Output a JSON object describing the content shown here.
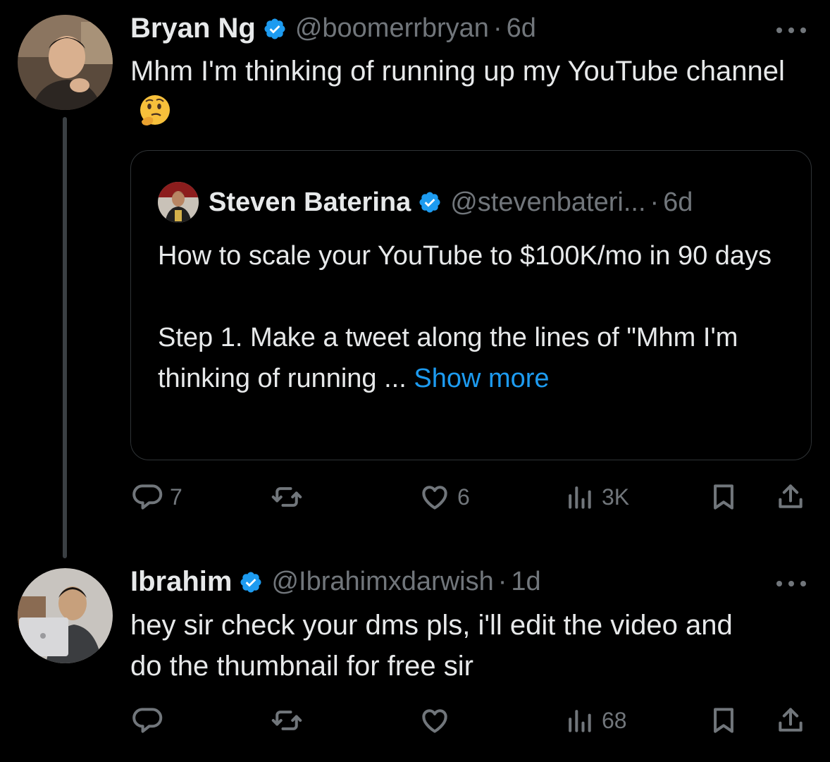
{
  "tweet1": {
    "author_name": "Bryan Ng",
    "handle": "@boomerrbryan",
    "dot": "·",
    "time": "6d",
    "text": "Mhm I'm thinking of running up my YouTube channel",
    "emoji": "thinking-face-emoji",
    "quote": {
      "author_name": "Steven Baterina",
      "handle": "@stevenbateri...",
      "dot": "·",
      "time": "6d",
      "paragraph1": "How to scale your YouTube to $100K/mo in 90 days",
      "paragraph2": "Step 1. Make a tweet along the lines of \"Mhm I'm thinking of running ...",
      "show_more": "Show more"
    },
    "actions": {
      "replies": "7",
      "reposts": "",
      "likes": "6",
      "views": "3K"
    }
  },
  "tweet2": {
    "author_name": "Ibrahim",
    "handle": "@Ibrahimxdarwish",
    "dot": "·",
    "time": "1d",
    "text": "hey sir check your dms pls, i'll edit the video and do the thumbnail for free sir",
    "actions": {
      "replies": "",
      "reposts": "",
      "likes": "",
      "views": "68"
    }
  },
  "colors": {
    "background": "#000000",
    "primary_text": "#e7e9ea",
    "secondary_text": "#71767b",
    "accent_link": "#1d9bf0",
    "verified_badge": "#1d9bf0",
    "thread_line": "#3a3f43"
  }
}
